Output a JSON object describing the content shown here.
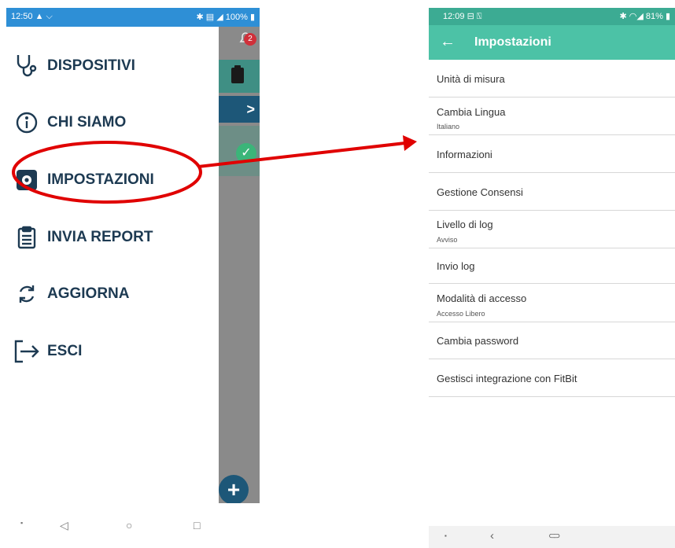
{
  "left_screen": {
    "status": {
      "time": "12:50 ▲ ⌵",
      "indicators": "✱ ▤ ◢ 100% ▮"
    },
    "notification_count": "2",
    "menu": [
      {
        "label": "DISPOSITIVI",
        "icon": "stethoscope-icon"
      },
      {
        "label": "CHI SIAMO",
        "icon": "info-icon"
      },
      {
        "label": "IMPOSTAZIONI",
        "icon": "gear-icon"
      },
      {
        "label": "INVIA REPORT",
        "icon": "clipboard-icon"
      },
      {
        "label": "AGGIORNA",
        "icon": "refresh-icon"
      },
      {
        "label": "ESCI",
        "icon": "logout-icon"
      }
    ],
    "nav": {
      "back": "◁",
      "home": "○",
      "recents": "□"
    }
  },
  "right_screen": {
    "status": {
      "time": "12:09 ⊟ ⍂",
      "indicators": "✱ ◠◢ 81% ▮"
    },
    "title": "Impostazioni",
    "settings": [
      {
        "title": "Unità di misura",
        "subtitle": ""
      },
      {
        "title": "Cambia Lingua",
        "subtitle": "Italiano"
      },
      {
        "title": "Informazioni",
        "subtitle": ""
      },
      {
        "title": "Gestione Consensi",
        "subtitle": ""
      },
      {
        "title": "Livello di log",
        "subtitle": "Avviso"
      },
      {
        "title": "Invio log",
        "subtitle": ""
      },
      {
        "title": "Modalità di accesso",
        "subtitle": "Accesso Libero"
      },
      {
        "title": "Cambia password",
        "subtitle": ""
      },
      {
        "title": "Gestisci integrazione con FitBit",
        "subtitle": ""
      }
    ],
    "nav": {
      "back": "‹",
      "home": "⊂⊃"
    }
  },
  "colors": {
    "drawer_text": "#1d3a52",
    "status_left": "#2e8fd6",
    "appbar": "#4cc2a6",
    "annotation": "#e00000"
  }
}
